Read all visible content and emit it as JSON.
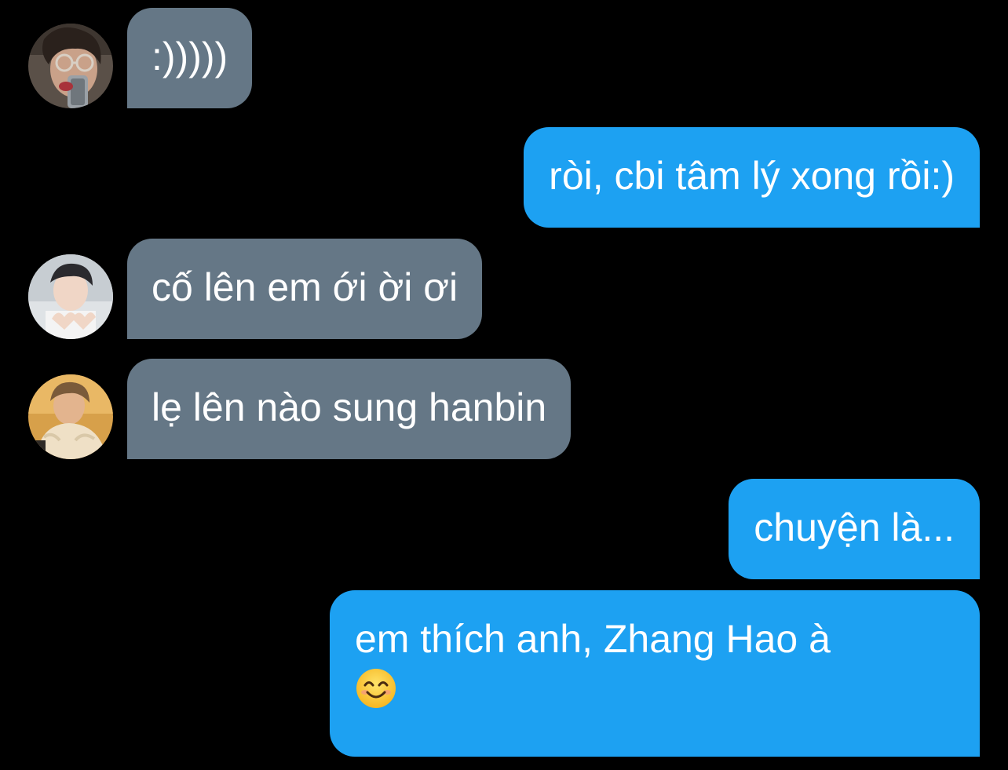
{
  "colors": {
    "background": "#000000",
    "received_bubble": "#657786",
    "sent_bubble": "#1da1f2",
    "text": "#ffffff"
  },
  "messages": [
    {
      "direction": "received",
      "avatar": "avatar-user-glasses",
      "text": ":)))))"
    },
    {
      "direction": "sent",
      "text": "ròi, cbi tâm lý xong rồi:)"
    },
    {
      "direction": "received",
      "avatar": "avatar-user-heart-hands",
      "text": "cố lên em ới ời ơi"
    },
    {
      "direction": "received",
      "avatar": "avatar-user-sweater",
      "text": "lẹ lên nào sung hanbin"
    },
    {
      "direction": "sent",
      "text": "chuyện là..."
    },
    {
      "direction": "sent",
      "text": "em thích anh, Zhang Hao à",
      "emoji": "smiling-face-emoji"
    }
  ]
}
